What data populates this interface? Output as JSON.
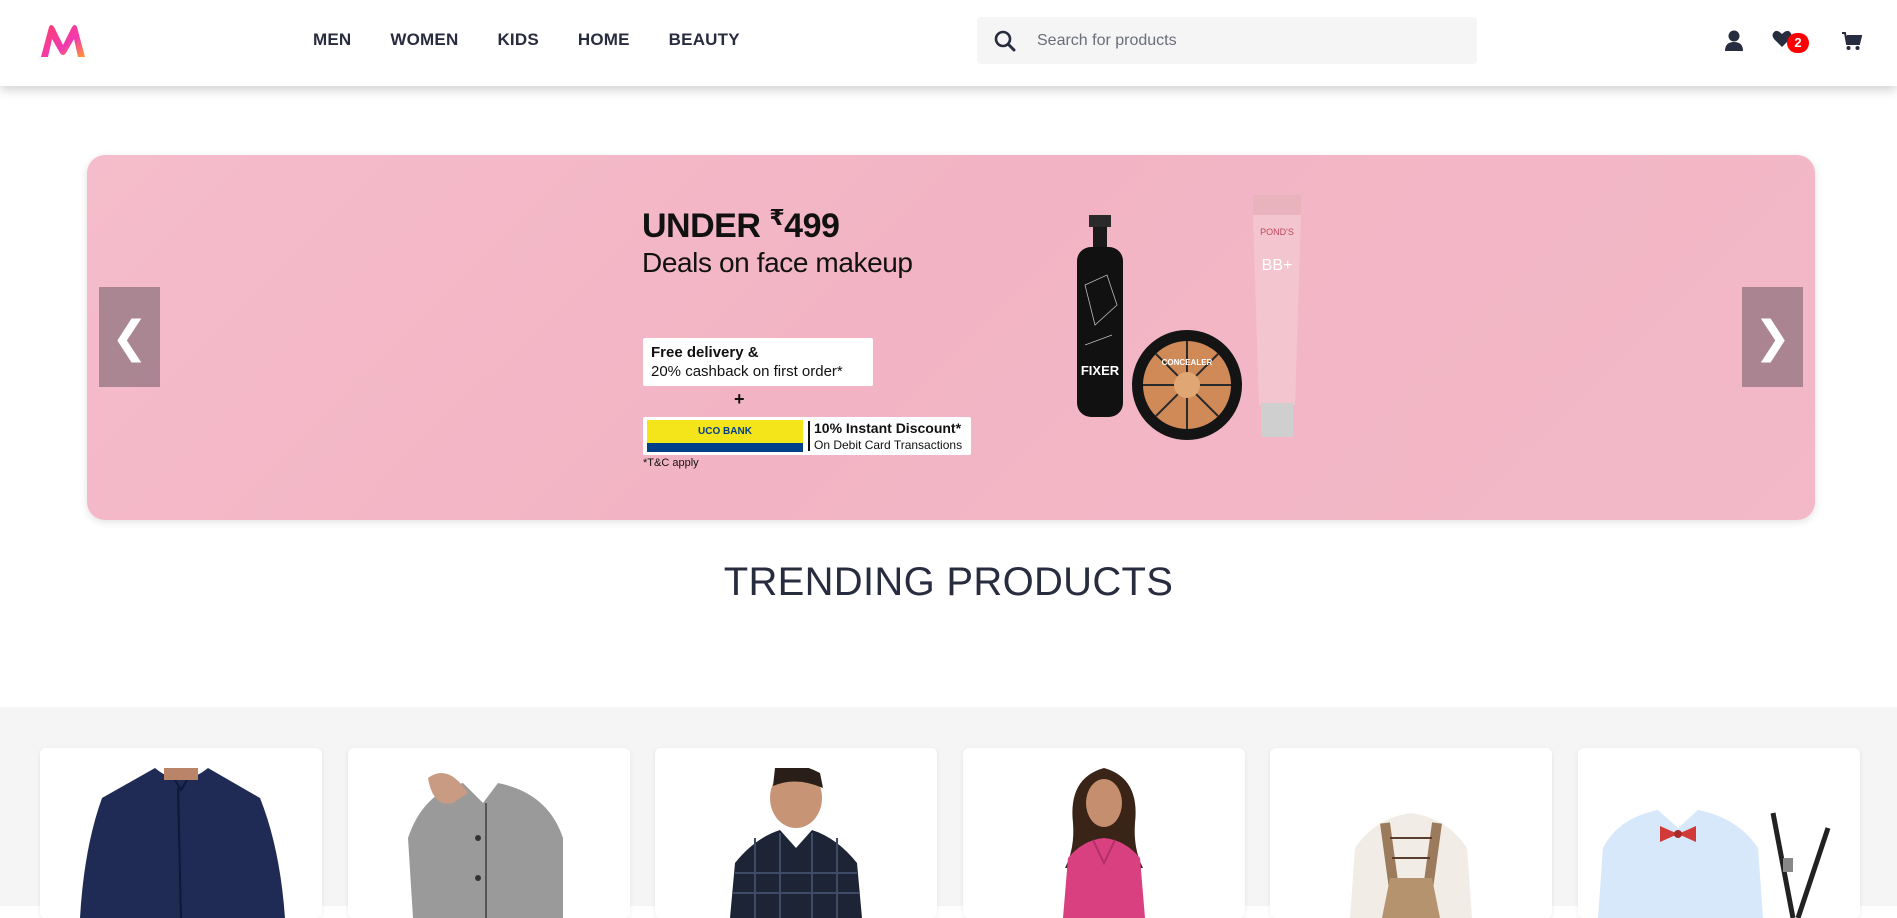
{
  "header": {
    "nav": [
      "MEN",
      "WOMEN",
      "KIDS",
      "HOME",
      "BEAUTY"
    ],
    "search_placeholder": "Search for products",
    "wishlist_count": "2",
    "icons": [
      "profile-icon",
      "heart-icon",
      "cart-icon"
    ]
  },
  "banner": {
    "title_prefix": "UNDER ",
    "currency": "₹",
    "title_amount": "499",
    "subtitle": "Deals on face makeup",
    "offer_line1": "Free delivery &",
    "offer_line2": "20% cashback on first order*",
    "plus": "+",
    "bank_name": "UCO BANK",
    "bank_offer_line1": "10% Instant Discount*",
    "bank_offer_line2": "On Debit Card Transactions",
    "tnc": "*T&C apply",
    "product_labels": [
      "FIXER",
      "CONCEALER",
      "BB+",
      "POND'S"
    ],
    "prev_arrow": "❮",
    "next_arrow": "❯"
  },
  "trending": {
    "title": "TRENDING PRODUCTS",
    "products": [
      {
        "name": "navy-kurta-shirt"
      },
      {
        "name": "grey-satin-shirt"
      },
      {
        "name": "navy-check-shirt"
      },
      {
        "name": "pink-top"
      },
      {
        "name": "kids-pinafore-dress"
      },
      {
        "name": "kids-bowtie-shirt-suspenders"
      }
    ]
  },
  "colors": {
    "brand_gradient": [
      "#ff3f6c",
      "#f13ab1",
      "#ff9a2a"
    ],
    "banner_bg": "#f2b4c4",
    "badge": "#ff0000"
  }
}
